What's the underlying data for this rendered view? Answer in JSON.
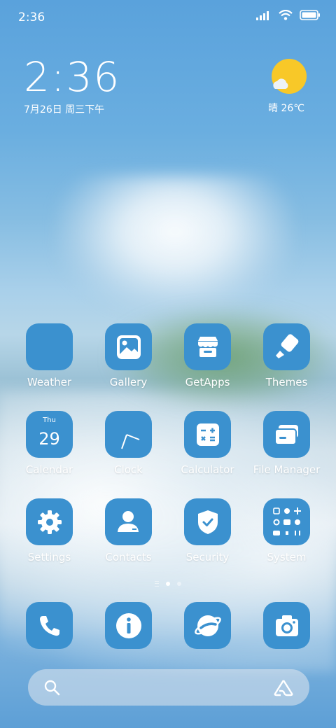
{
  "status_bar": {
    "time": "2:36"
  },
  "clock_widget": {
    "time": "2:36",
    "date": "7月26日 周三下午"
  },
  "weather_widget": {
    "text": "晴 26℃"
  },
  "apps": [
    [
      {
        "label": "Weather",
        "icon": "weather-icon"
      },
      {
        "label": "Gallery",
        "icon": "gallery-icon"
      },
      {
        "label": "GetApps",
        "icon": "store-icon"
      },
      {
        "label": "Themes",
        "icon": "brush-icon"
      }
    ],
    [
      {
        "label": "Calendar",
        "icon": "calendar-icon",
        "day": "Thu",
        "date": "29"
      },
      {
        "label": "Clock",
        "icon": "clock-icon"
      },
      {
        "label": "Calculator",
        "icon": "calculator-icon"
      },
      {
        "label": "File Manager",
        "icon": "folder-icon"
      }
    ],
    [
      {
        "label": "Settings",
        "icon": "gear-icon"
      },
      {
        "label": "Contacts",
        "icon": "person-icon"
      },
      {
        "label": "Security",
        "icon": "shield-icon"
      },
      {
        "label": "System",
        "icon": "folder-grid-icon"
      }
    ]
  ],
  "dock": [
    {
      "icon": "phone-icon"
    },
    {
      "icon": "info-icon"
    },
    {
      "icon": "browser-icon"
    },
    {
      "icon": "camera-icon"
    }
  ],
  "colors": {
    "icon_bg": "#3b91cf",
    "sun": "#f8c828"
  }
}
